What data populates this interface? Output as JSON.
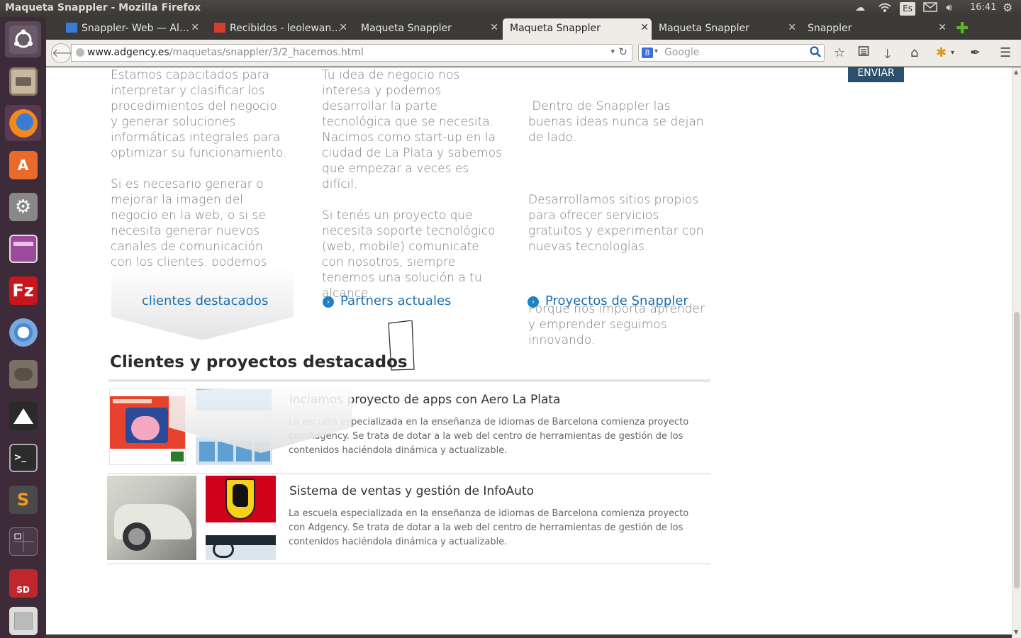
{
  "system": {
    "window_title": "Maqueta Snappler - Mozilla Firefox",
    "keyboard_layout": "Es",
    "clock": "16:41"
  },
  "launcher": {
    "items": [
      "ubuntu-dash",
      "files",
      "firefox",
      "software-center",
      "system-settings",
      "workspace-switcher",
      "filezilla",
      "chromium",
      "gimp",
      "inkscape",
      "terminal",
      "sublime-text",
      "workspaces",
      "sd-card",
      "trash"
    ]
  },
  "tabs": [
    {
      "label": "Snappler- Web — Al…",
      "active": false
    },
    {
      "label": "Recibidos - leolewan…",
      "active": false
    },
    {
      "label": "Maqueta Snappler",
      "active": false
    },
    {
      "label": "Maqueta Snappler",
      "active": true
    },
    {
      "label": "Maqueta Snappler",
      "active": false
    },
    {
      "label": "Snappler",
      "active": false
    }
  ],
  "navbar": {
    "url_host": "www.adgency.es",
    "url_path": "/maquetas/snappler/3/2_hacemos.html",
    "search_placeholder": "Google",
    "search_engine_letter": "8"
  },
  "page": {
    "enviar_label": "ENVIAR",
    "columns": [
      {
        "paragraphs": [
          "Estamos capacitados para interpretar y clasificar los procedimientos del negocio y generar soluciones informáticas integrales para optimizar su funcionamiento.",
          "Si es necesario generar o mejorar la imagen del negocio en la web, o si se necesita generar nuevos canales de comunicación con los clientes, podemos ayudarte."
        ],
        "link": "clientes destacados"
      },
      {
        "paragraphs": [
          "Tu idea de negocio nos interesa y podemos desarrollar la parte tecnológica que se necesita. Nacimos como start-up en la ciudad de La Plata y sabemos que empezar a veces es difícil.",
          "Si tenés un proyecto que necesita soporte tecnológico (web, mobile) comunicate con nosotros, siempre tenemos una solución a tu alcance."
        ],
        "link": "Partners actuales"
      },
      {
        "paragraphs": [
          " Dentro de Snappler las buenas ideas nunca se dejan de lado.",
          "Desarrollamos sitios propios para ofrecer servicios gratuitos y experimentar con nuevas tecnologías.",
          "Porque nos importa aprender y emprender seguimos innovando."
        ],
        "link": "Proyectos de Snappler"
      }
    ],
    "section_heading": "Clientes y proyectos destacados",
    "projects": [
      {
        "title": "Inciamos proyecto de apps con Aero La Plata",
        "description": "La escuela especializada en la enseñanza de idiomas de Barcelona comienza proyecto con Adgency. Se trata de dotar a la web del centro de herramientas de gestión de los contenidos haciéndola dinámica y actualizable."
      },
      {
        "title": "Sistema de ventas y gestión de InfoAuto",
        "description": "La escuela especializada en la enseñanza de idiomas de Barcelona comienza proyecto con Adgency. Se trata de dotar a la web del centro de herramientas de gestión de los contenidos haciéndola dinámica y actualizable."
      }
    ]
  },
  "colors": {
    "link_blue": "#1b6fb0",
    "enviar_bg": "#2b4f6e",
    "ferrari_red": "#d0021b",
    "ferrari_yellow": "#f7d117"
  }
}
